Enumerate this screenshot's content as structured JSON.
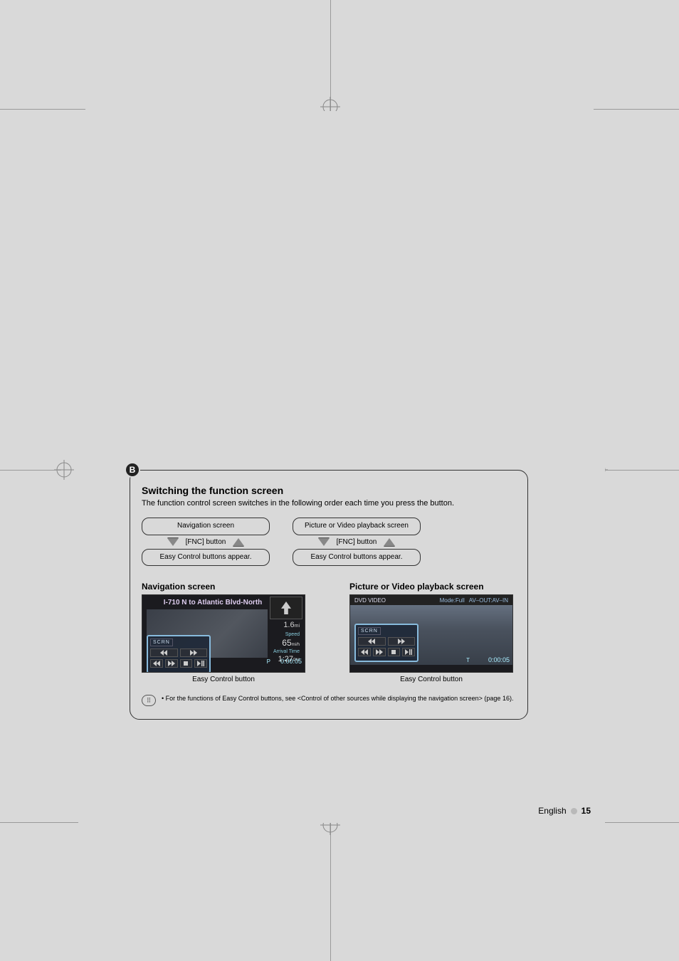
{
  "section": {
    "badge": "B",
    "title": "Switching the function screen",
    "desc": "The function control screen switches in the following order each time you press the button."
  },
  "flow": {
    "left": {
      "top": "Navigation screen",
      "mid": "[FNC] button",
      "bottom": "Easy Control buttons appear."
    },
    "right": {
      "top": "Picture or Video playback screen",
      "mid": "[FNC] button",
      "bottom": "Easy Control buttons appear."
    }
  },
  "screenshots": {
    "nav": {
      "heading": "Navigation screen",
      "title": "I-710 N to Atlantic Blvd-North",
      "distance": "1.6",
      "distance_unit": "mi",
      "speed_label": "Speed",
      "speed": "65",
      "speed_unit": "mi/h",
      "arrival_label": "Arrival Time",
      "arrival": "1:27",
      "arrival_unit": "PM",
      "scrn": "SCRN",
      "p": "P",
      "time": "0:00:05",
      "caption": "Easy Control button"
    },
    "dvd": {
      "heading": "Picture or Video playback screen",
      "source": "DVD VIDEO",
      "mode": "Mode:Full",
      "avout": "AV–OUT:AV–IN",
      "scrn": "SCRN",
      "t": "T",
      "time": "0:00:05",
      "caption": "Easy Control button"
    }
  },
  "note": {
    "bullet": "•",
    "text": "For the functions of Easy Control buttons, see <Control of other sources while displaying the navigation screen> (page 16)."
  },
  "footer": {
    "lang": "English",
    "page": "15"
  }
}
